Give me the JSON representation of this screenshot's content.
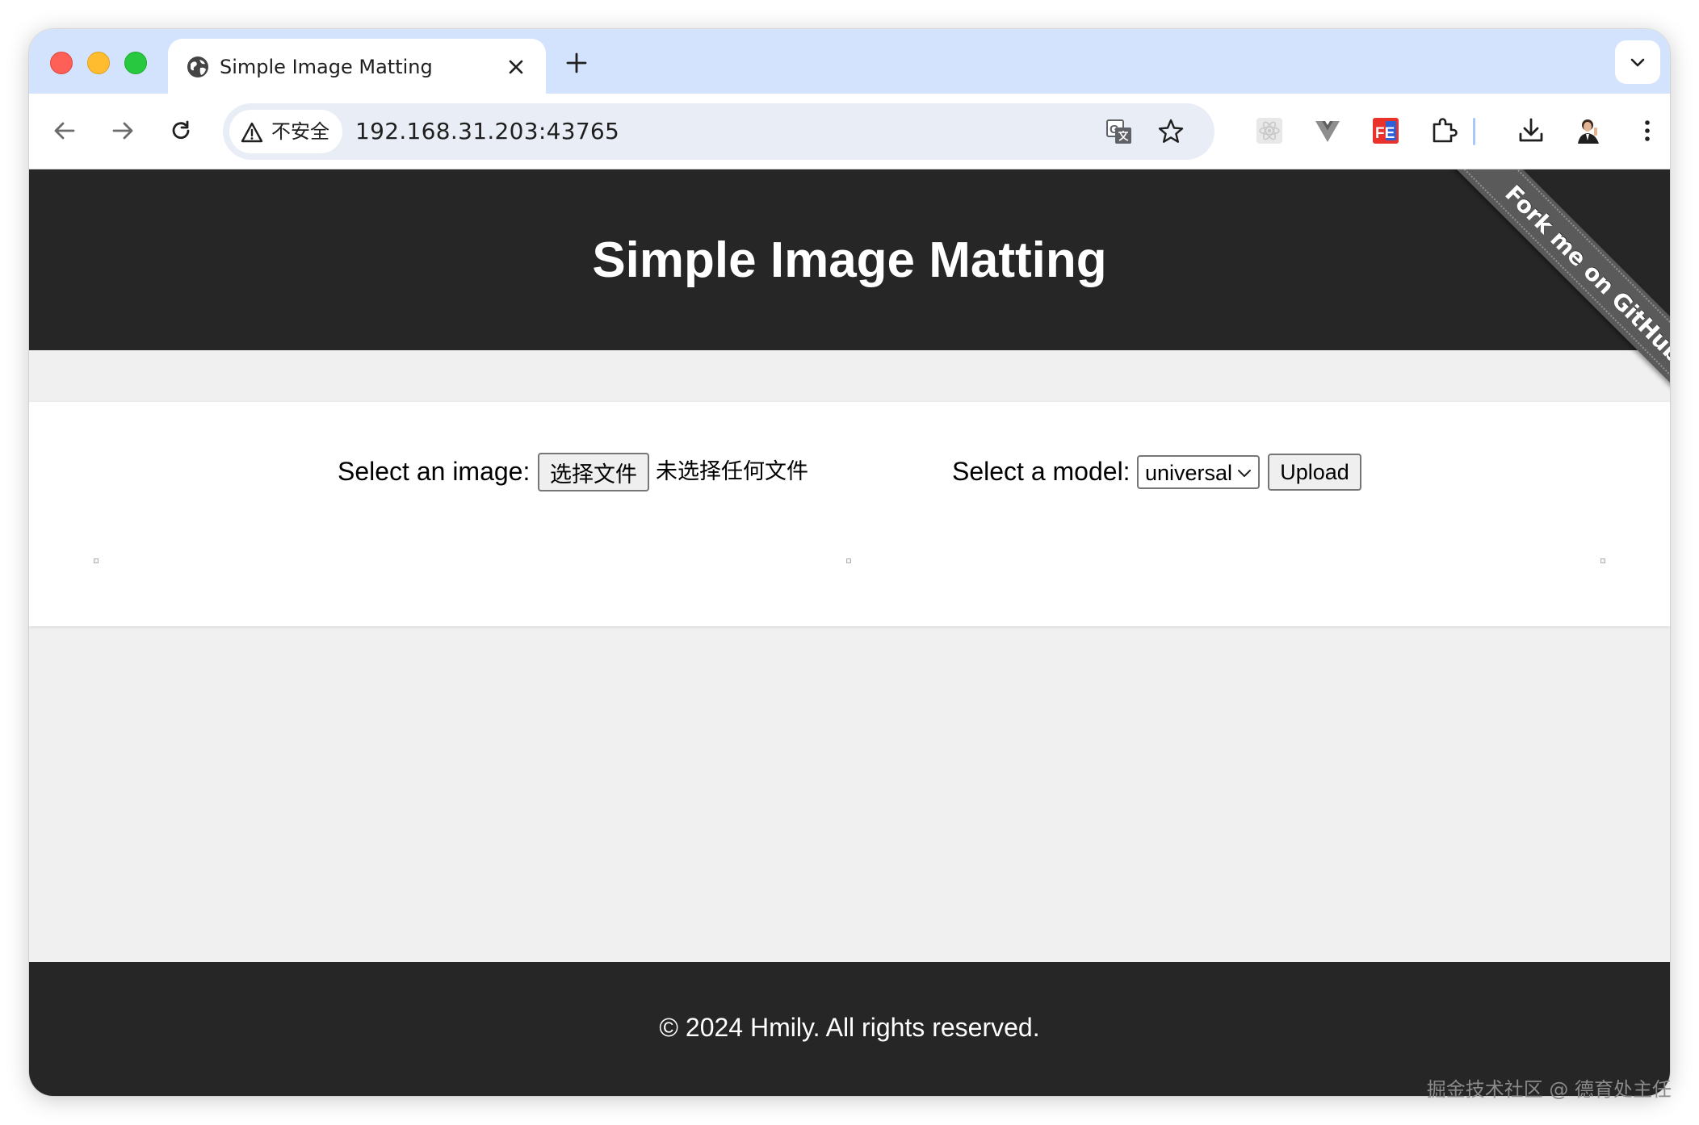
{
  "browser": {
    "tab": {
      "title": "Simple Image Matting",
      "icon": "globe-icon"
    },
    "address": {
      "security_label": "不安全",
      "url": "192.168.31.203:43765"
    },
    "colors": {
      "tabstrip": "#d3e3fd",
      "omnibox": "#e9eef6"
    }
  },
  "page": {
    "header_title": "Simple Image Matting",
    "ribbon_text": "Fork me on GitHub",
    "form": {
      "image_label": "Select an image:",
      "file_button": "选择文件",
      "file_status": "未选择任何文件",
      "model_label": "Select a model:",
      "model_value": "universal",
      "upload_button": "Upload"
    },
    "footer_text": "© 2024 Hmily. All rights reserved.",
    "colors": {
      "header_bg": "#262626",
      "page_bg": "#f0f0f0"
    }
  },
  "watermark": "掘金技术社区 @ 德育处主任"
}
